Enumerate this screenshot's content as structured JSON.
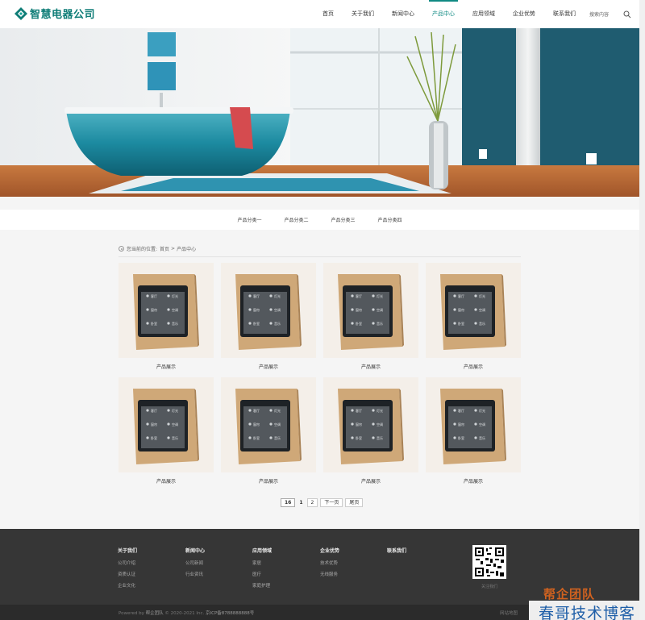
{
  "header": {
    "logo_text": "智慧电器公司",
    "nav": [
      "首页",
      "关于我们",
      "新闻中心",
      "产品中心",
      "应用领域",
      "企业优势",
      "联系我们"
    ],
    "active_nav": "产品中心",
    "search_label": "搜索内容"
  },
  "categories": [
    "产品分类一",
    "产品分类二",
    "产品分类三",
    "产品分类四"
  ],
  "breadcrumb": {
    "prefix": "您当前的位置:",
    "home": "首页",
    "separator": ">",
    "current": "产品中心"
  },
  "products": [
    {
      "caption": "产品展示"
    },
    {
      "caption": "产品展示"
    },
    {
      "caption": "产品展示"
    },
    {
      "caption": "产品展示"
    },
    {
      "caption": "产品展示"
    },
    {
      "caption": "产品展示"
    },
    {
      "caption": "产品展示"
    },
    {
      "caption": "产品展示"
    }
  ],
  "switch_labels": [
    "客厅",
    "灯光",
    "窗帘",
    "空调",
    "卧室",
    "音乐"
  ],
  "pager": {
    "total": "16",
    "current": "1",
    "page2": "2",
    "next": "下一页",
    "last": "尾页"
  },
  "footer": {
    "columns": [
      {
        "title": "关于我们",
        "links": [
          "公司介绍",
          "资质认证",
          "企业文化"
        ]
      },
      {
        "title": "新闻中心",
        "links": [
          "公司新闻",
          "行业资讯"
        ]
      },
      {
        "title": "应用领域",
        "links": [
          "家居",
          "医疗",
          "家庭护理"
        ]
      },
      {
        "title": "企业优势",
        "links": [
          "技术优势",
          "无线服务"
        ]
      },
      {
        "title": "联系我们",
        "links": []
      }
    ],
    "qr_caption": "关注我们",
    "powered_prefix": "Powered by",
    "powered_by": "帮企团队",
    "copyright": "© 2020-2021 Inc.",
    "icp": "京ICP备8788888888号",
    "sitemap": "网站地图"
  },
  "watermark": {
    "top": "帮企团队",
    "bottom": "春哥技术博客"
  },
  "colors": {
    "brand": "#0f8a83",
    "footer_bg": "#363636",
    "card_bg": "#f4efe9"
  }
}
